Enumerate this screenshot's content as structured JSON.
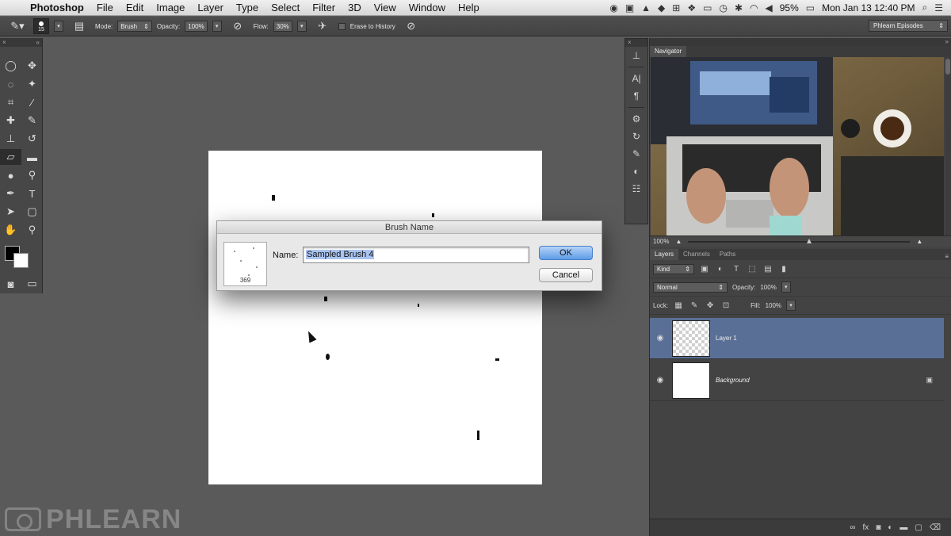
{
  "menubar": {
    "app_name": "Photoshop",
    "items": [
      "File",
      "Edit",
      "Image",
      "Layer",
      "Type",
      "Select",
      "Filter",
      "3D",
      "View",
      "Window",
      "Help"
    ],
    "battery": "95%",
    "datetime": "Mon Jan 13  12:40 PM"
  },
  "options": {
    "brush_size": "15",
    "mode_label": "Mode:",
    "mode_value": "Brush",
    "opacity_label": "Opacity:",
    "opacity_value": "100%",
    "flow_label": "Flow:",
    "flow_value": "30%",
    "erase_history_label": "Erase to History",
    "workspace": "Phlearn Episodes"
  },
  "dialog": {
    "title": "Brush Name",
    "thumb_count": "369",
    "name_label": "Name:",
    "name_value": "Sampled Brush 4",
    "ok_label": "OK",
    "cancel_label": "Cancel"
  },
  "navigator": {
    "tab": "Navigator",
    "zoom": "100%"
  },
  "layers": {
    "tabs": [
      "Layers",
      "Channels",
      "Paths"
    ],
    "kind_label": "Kind",
    "blend_mode": "Normal",
    "opacity_label": "Opacity:",
    "opacity_value": "100%",
    "lock_label": "Lock:",
    "fill_label": "Fill:",
    "fill_value": "100%",
    "items": [
      {
        "name": "Layer 1"
      },
      {
        "name": "Background"
      }
    ]
  },
  "watermark": "PHLEARN",
  "colors": {
    "selected_layer": "#5a6f96",
    "ok_button": "#5d9ce8"
  }
}
